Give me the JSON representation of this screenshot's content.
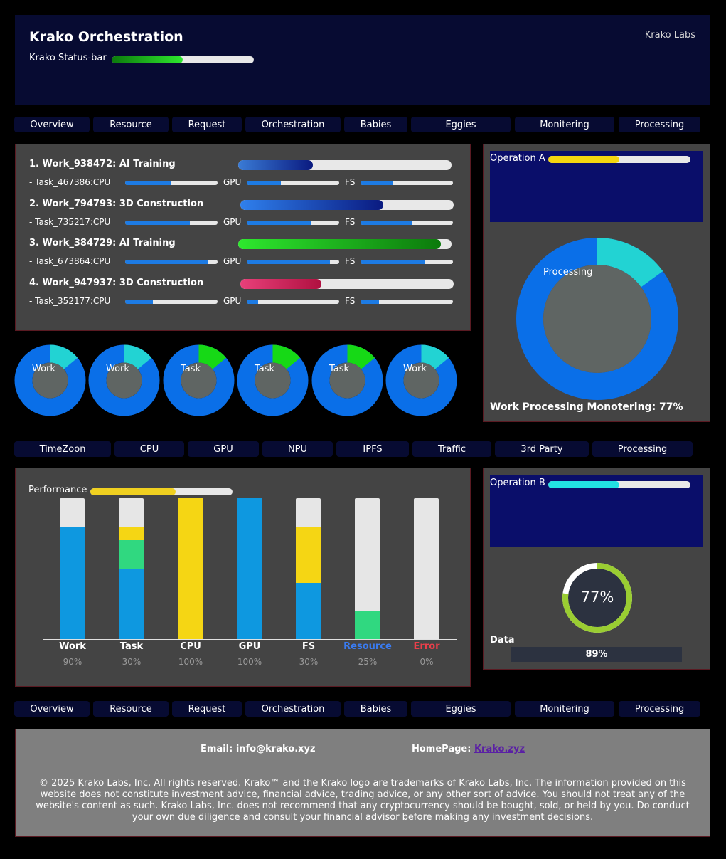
{
  "header": {
    "title": "Krako Orchestration",
    "company": "Krako Labs",
    "statusbar_label": "Krako Status-bar",
    "statusbar_progress": 0.5
  },
  "nav_top": [
    "Overview",
    "Resource",
    "Request",
    "Orchestration",
    "Babies",
    "Eggies",
    "Monitering",
    "Processing"
  ],
  "works": [
    {
      "title": "1. Work_938472: AI Training",
      "progress": 0.35,
      "color_from": "#3a7bd5",
      "color_to": "#0a1a80",
      "task": "- Task_467386:CPU",
      "cpu": 0.5,
      "gpu": 0.37,
      "fs": 0.35
    },
    {
      "title": "2. Work_794793: 3D Construction",
      "progress": 0.67,
      "color_from": "#2f80ed",
      "color_to": "#0a1a80",
      "task": "- Task_735217:CPU",
      "cpu": 0.7,
      "gpu": 0.7,
      "fs": 0.55
    },
    {
      "title": "3. Work_384729: AI Training",
      "progress": 0.95,
      "color_from": "#2ee82e",
      "color_to": "#0c7a0c",
      "task": "- Task_673864:CPU",
      "cpu": 0.9,
      "gpu": 0.9,
      "fs": 0.7
    },
    {
      "title": "4. Work_947937: 3D Construction",
      "progress": 0.38,
      "color_from": "#e8407a",
      "color_to": "#b01040",
      "task": "- Task_352177:CPU",
      "cpu": 0.3,
      "gpu": 0.12,
      "fs": 0.2
    }
  ],
  "resource_labels": {
    "gpu": "GPU",
    "fs": "FS"
  },
  "small_donuts": [
    {
      "label": "Work",
      "fraction": 0.14,
      "color": "#22d3d3"
    },
    {
      "label": "Work",
      "fraction": 0.14,
      "color": "#22d3d3"
    },
    {
      "label": "Task",
      "fraction": 0.14,
      "color": "#16d916"
    },
    {
      "label": "Task",
      "fraction": 0.14,
      "color": "#16d916"
    },
    {
      "label": "Task",
      "fraction": 0.14,
      "color": "#16d916"
    },
    {
      "label": "Work",
      "fraction": 0.14,
      "color": "#22d3d3"
    }
  ],
  "operation_a": {
    "label": "Operation A",
    "progress": 0.5,
    "color": "#f5d60f",
    "donut_label": "Processing",
    "donut_fraction": 0.15,
    "footer": "Work Processing Monotering: 77%"
  },
  "nav_mid": [
    "TimeZoon",
    "CPU",
    "GPU",
    "NPU",
    "IPFS",
    "Traffic",
    "3rd Party",
    "Processing"
  ],
  "performance": {
    "label": "Performance",
    "progress": 0.6,
    "color": "#f0d020"
  },
  "chart_data": {
    "type": "bar",
    "stacked": true,
    "categories": [
      "Work",
      "Task",
      "CPU",
      "GPU",
      "FS",
      "Resource",
      "Error"
    ],
    "percent_labels": [
      "90%",
      "30%",
      "100%",
      "100%",
      "30%",
      "25%",
      "0%"
    ],
    "label_colors": [
      "#ffffff",
      "#ffffff",
      "#ffffff",
      "#ffffff",
      "#ffffff",
      "#3a7bf0",
      "#ea3f4a"
    ],
    "series": [
      {
        "color": "#0e98e0",
        "values": [
          80,
          50,
          0,
          100,
          40,
          0,
          0
        ]
      },
      {
        "color": "#30d880",
        "values": [
          0,
          20,
          0,
          0,
          0,
          20,
          0
        ]
      },
      {
        "color": "#f5d614",
        "values": [
          0,
          10,
          100,
          0,
          40,
          0,
          0
        ]
      }
    ],
    "ylim": [
      0,
      100
    ],
    "background_color": "#e6e6e6"
  },
  "operation_b": {
    "label": "Operation B",
    "progress": 0.5,
    "color": "#22e3e3",
    "gauge_value": "77%",
    "gauge_fraction": 0.77,
    "data_label": "Data",
    "data_value": "89%"
  },
  "nav_bottom": [
    "Overview",
    "Resource",
    "Request",
    "Orchestration",
    "Babies",
    "Eggies",
    "Monitering",
    "Processing"
  ],
  "footer": {
    "email_label": "Email:",
    "email": "info@krako.xyz",
    "homepage_label": "HomePage:",
    "homepage": "Krako.zyz",
    "copyright": "© 2025 Krako Labs, Inc. All rights reserved. Krako™ and the Krako logo are trademarks of Krako Labs, Inc. The information provided on this website does not constitute investment advice, financial advice, trading advice, or any other sort of advice. You should not treat any of the website's content as such. Krako Labs, Inc. does not recommend that any cryptocurrency should be bought, sold, or held by you. Do conduct your own due diligence and consult your financial advisor before making any investment decisions."
  }
}
